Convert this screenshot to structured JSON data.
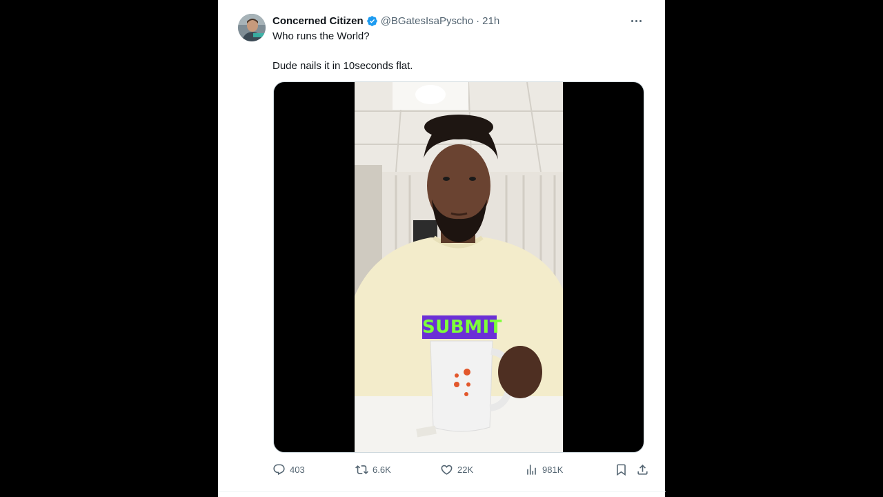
{
  "tweet": {
    "display_name": "Concerned Citizen",
    "handle": "@BGatesIsaPyscho",
    "separator": "·",
    "time": "21h",
    "text_line1": "Who runs the World?",
    "text_line2": "Dude nails it in 10seconds flat."
  },
  "video": {
    "overlay_label": "SUBMIT",
    "overlay_bg": "#6b2fd6",
    "overlay_text_color": "#7dff3a"
  },
  "actions": {
    "reply_count": "403",
    "retweet_count": "6.6K",
    "like_count": "22K",
    "views_count": "981K"
  },
  "icons": {
    "verified": "verified-badge-icon",
    "more": "more-dots-icon",
    "reply": "reply-bubble-icon",
    "retweet": "retweet-icon",
    "like": "heart-icon",
    "views": "bar-chart-icon",
    "bookmark": "bookmark-icon",
    "share": "share-upload-icon"
  },
  "colors": {
    "verified_blue": "#1d9bf0",
    "secondary_text": "#536471",
    "primary_text": "#0f1419"
  }
}
